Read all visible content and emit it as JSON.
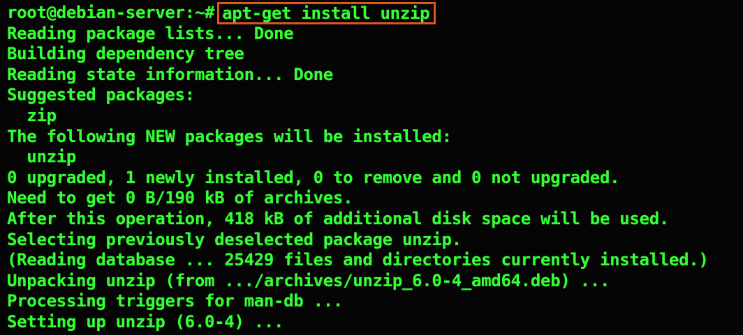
{
  "terminal": {
    "prompt": "root@debian-server:~#",
    "command": "apt-get install unzip",
    "colors": {
      "text": "#33ff33",
      "background": "#050505",
      "highlight_border": "#e0541e"
    },
    "output": [
      "Reading package lists... Done",
      "Building dependency tree",
      "Reading state information... Done",
      "Suggested packages:",
      "  zip",
      "The following NEW packages will be installed:",
      "  unzip",
      "0 upgraded, 1 newly installed, 0 to remove and 0 not upgraded.",
      "Need to get 0 B/190 kB of archives.",
      "After this operation, 418 kB of additional disk space will be used.",
      "Selecting previously deselected package unzip.",
      "(Reading database ... 25429 files and directories currently installed.)",
      "Unpacking unzip (from .../archives/unzip_6.0-4_amd64.deb) ...",
      "Processing triggers for man-db ...",
      "Setting up unzip (6.0-4) ..."
    ]
  }
}
